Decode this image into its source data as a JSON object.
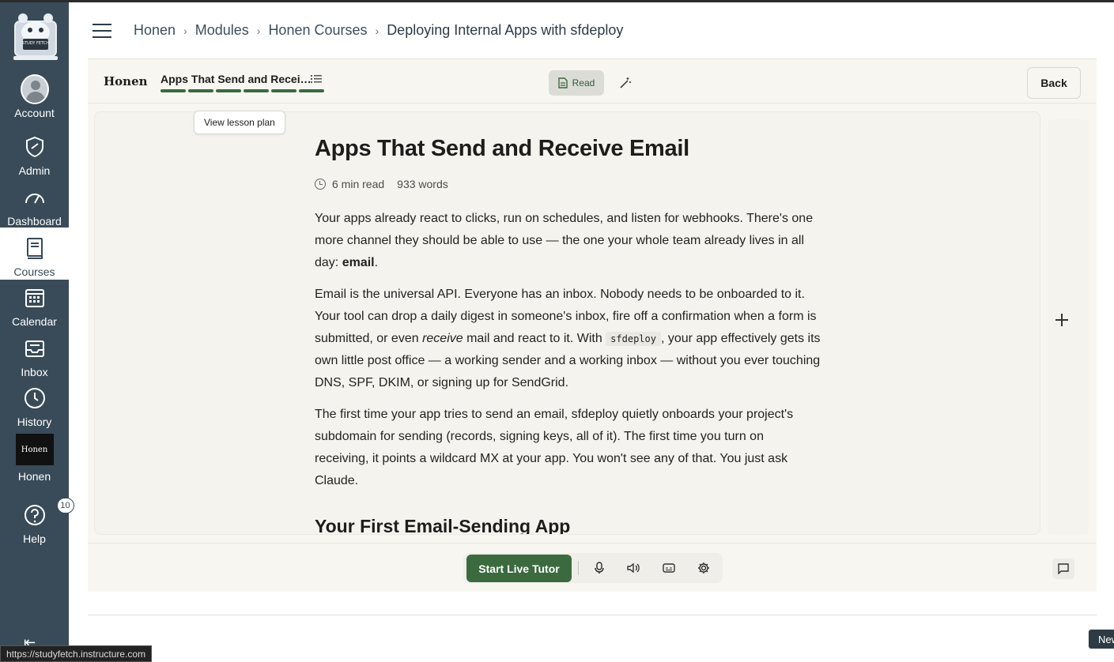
{
  "global_nav": {
    "logo_text": "STUDY FETCH",
    "items": [
      {
        "label": "Account",
        "icon": "account-avatar-icon"
      },
      {
        "label": "Admin",
        "icon": "shield-icon"
      },
      {
        "label": "Dashboard",
        "icon": "speedometer-icon"
      },
      {
        "label": "Courses",
        "icon": "book-icon",
        "active": true
      },
      {
        "label": "Calendar",
        "icon": "calendar-icon"
      },
      {
        "label": "Inbox",
        "icon": "inbox-icon"
      },
      {
        "label": "History",
        "icon": "clock-icon"
      },
      {
        "label": "Honen",
        "icon": "honen-logo",
        "tile_text": "Honen"
      },
      {
        "label": "Help",
        "icon": "help-icon",
        "badge": "10"
      }
    ]
  },
  "breadcrumb": {
    "items": [
      "Honen",
      "Modules",
      "Honen Courses"
    ],
    "current": "Deploying Internal Apps with sfdeploy"
  },
  "app": {
    "brand": "Honen",
    "lesson_title": "Apps That Send and Recei…",
    "progress_segments": 6,
    "read_label": "Read",
    "back_label": "Back",
    "tooltip": "View lesson plan"
  },
  "article": {
    "title": "Apps That Send and Receive Email",
    "read_time": "6 min read",
    "word_count": "933 words",
    "p1_a": "Your apps already react to clicks, run on schedules, and listen for webhooks. There's one more channel they should be able to use — the one your whole team already lives in all day: ",
    "p1_bold": "email",
    "p1_end": ".",
    "p2_a": "Email is the universal API. Everyone has an inbox. Nobody needs to be onboarded to it. Your tool can drop a daily digest in someone's inbox, fire off a confirmation when a form is submitted, or even ",
    "p2_em": "receive",
    "p2_b": " mail and react to it. With ",
    "p2_code": "sfdeploy",
    "p2_c": ", your app effectively gets its own little post office — a working sender and a working inbox — without you ever touching DNS, SPF, DKIM, or signing up for SendGrid.",
    "p3": "The first time your app tries to send an email, sfdeploy quietly onboards your project's subdomain for sending (records, signing keys, all of it). The first time you turn on receiving, it points a wildcard MX at your app. You won't see any of that. You just ask Claude.",
    "h2": "Your First Email-Sending App"
  },
  "footer": {
    "tutor_label": "Start Live Tutor"
  },
  "status_bar": {
    "url": "https://studyfetch.instructure.com"
  },
  "new_button": "New",
  "colors": {
    "nav_bg": "#394b58",
    "accent_green": "#3b6a3f",
    "app_bg": "#f7f6f1"
  }
}
